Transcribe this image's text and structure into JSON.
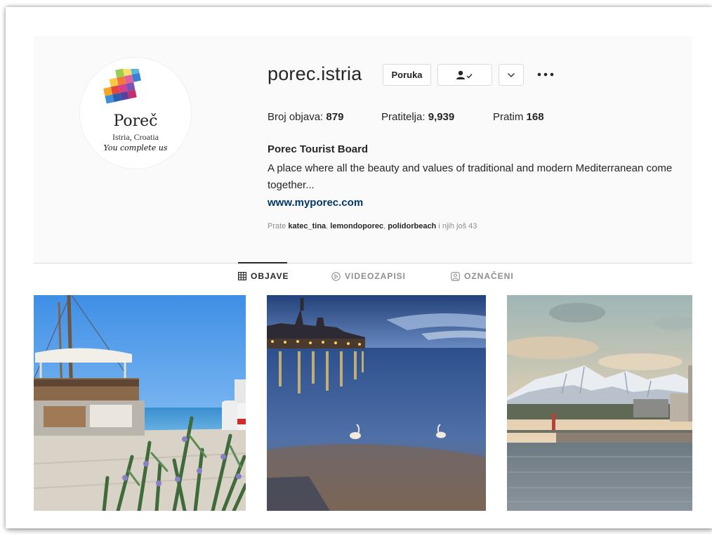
{
  "profile": {
    "username": "porec.istria",
    "logo": {
      "name": "Poreč",
      "region": "Istria, Croatia",
      "tagline": "You complete us"
    },
    "buttons": {
      "message_label": "Poruka",
      "following_icon": "person-check-icon",
      "dropdown_icon": "chevron-down-icon",
      "more_icon": "more-dots-icon"
    },
    "stats": {
      "posts_label": "Broj objava:",
      "posts_count": "879",
      "followers_label": "Pratitelja:",
      "followers_count": "9,939",
      "following_label": "Pratim",
      "following_count": "168"
    },
    "full_name": "Porec Tourist Board",
    "bio": "A place where all the beauty and values of traditional and modern Mediterranean come together...",
    "website": "www.myporec.com",
    "followed_by": {
      "prefix": "Prate",
      "user1": "katec_tina",
      "user2": "lemondoporec",
      "user3": "polidorbeach",
      "suffix": "i njih još 43"
    }
  },
  "tabs": [
    {
      "label": "OBJAVE",
      "icon": "grid-icon",
      "active": true
    },
    {
      "label": "VIDEOZAPISI",
      "icon": "play-circle-icon",
      "active": false
    },
    {
      "label": "OZNAČENI",
      "icon": "tag-person-icon",
      "active": false
    }
  ],
  "posts": [
    {
      "subject": "boat-harbor-rosemary"
    },
    {
      "subject": "evening-town-swans"
    },
    {
      "subject": "snowy-mountains-sea"
    }
  ],
  "colors": {
    "link": "#00376b",
    "muted": "#8e8e8e",
    "text": "#262626",
    "border": "#dbdbdb"
  }
}
